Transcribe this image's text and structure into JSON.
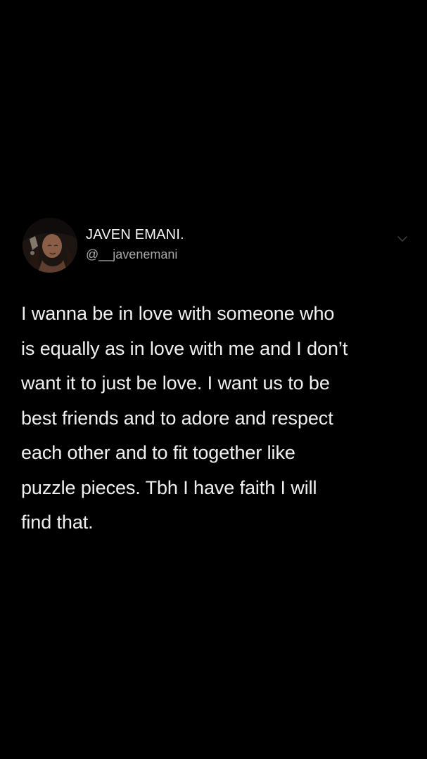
{
  "tweet": {
    "author": {
      "display_name": "JAVEN EMANI.",
      "handle": "@__javenemani",
      "avatar_icon": "avatar-photo"
    },
    "more_icon": "chevron-down-icon",
    "text_lines": [
      "I wanna be in love with someone who",
      "is equally as in love with me and I don’t",
      "want it to just be love. I want us to be",
      "best friends and to adore and respect",
      "each other and to fit together like",
      "puzzle pieces. Tbh I have faith I will",
      "find that."
    ]
  },
  "colors": {
    "background": "#000000",
    "primary_text": "#f2f2f2",
    "secondary_text": "#a8a8a8"
  }
}
